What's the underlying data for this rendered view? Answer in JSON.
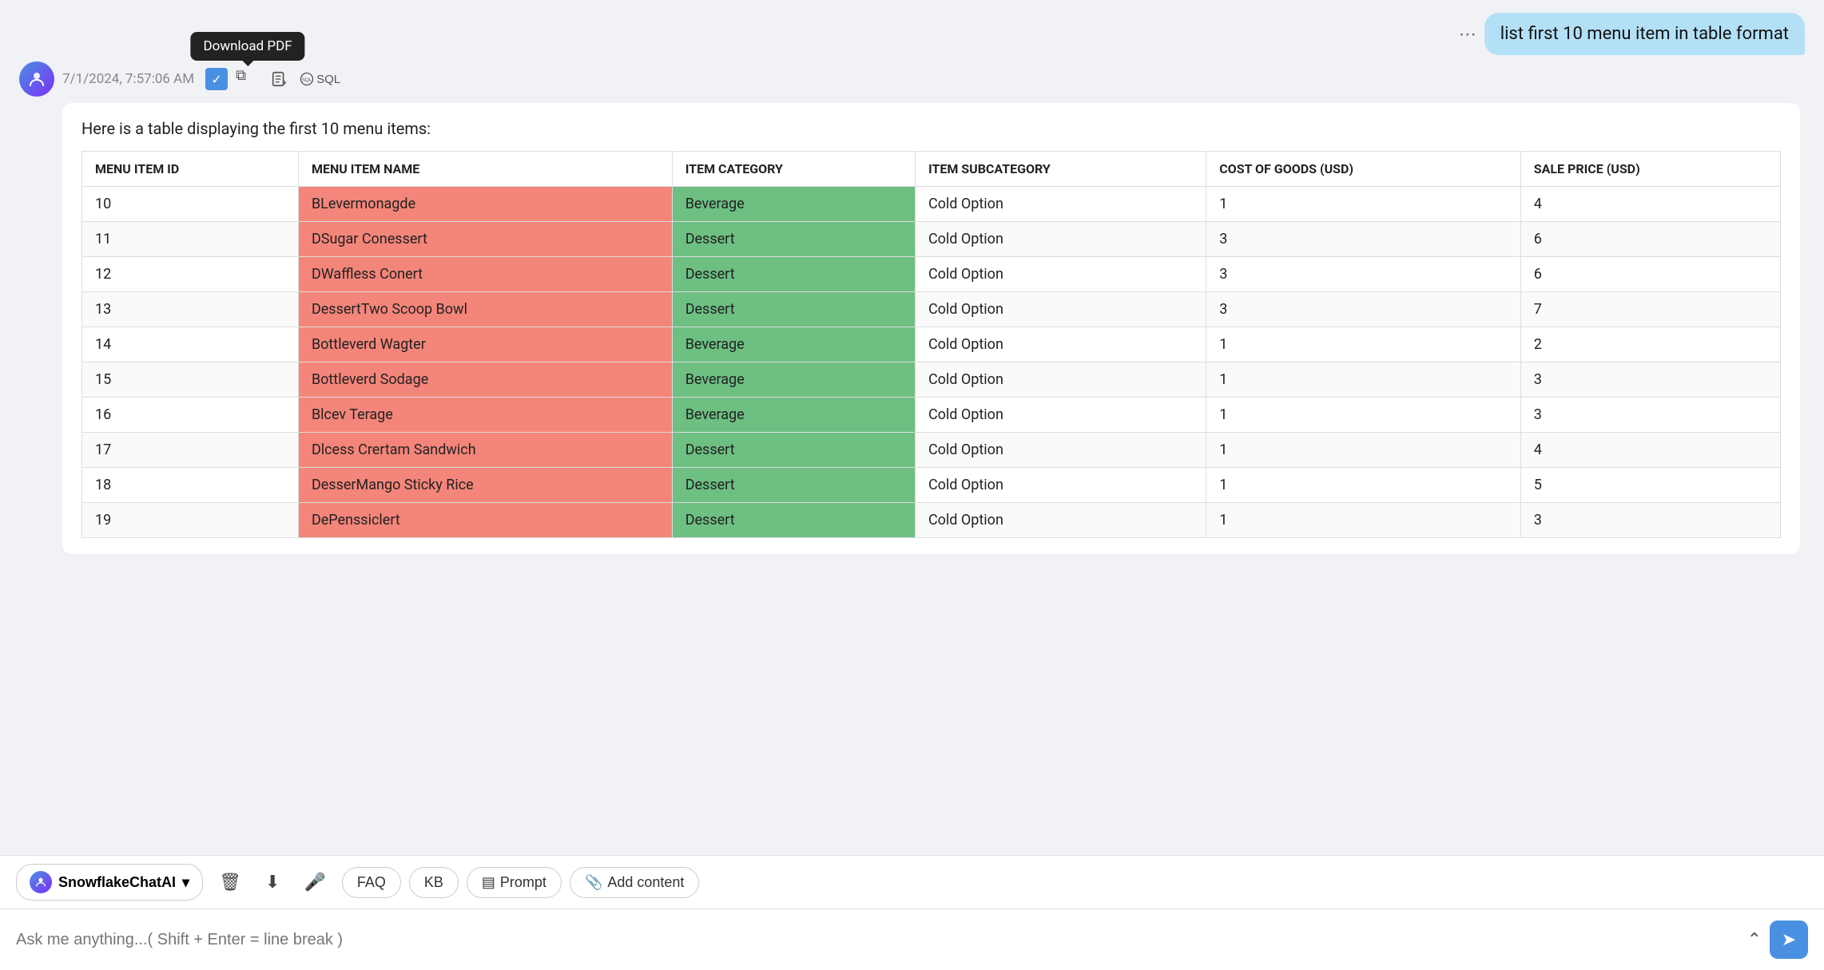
{
  "userMessage": {
    "text": "list first 10 menu item in table format"
  },
  "botMessage": {
    "timestamp": "7/1/2024, 7:57:06 AM",
    "intro": "Here is a table displaying the first 10 menu items:",
    "tooltip": "Download PDF"
  },
  "table": {
    "headers": [
      "MENU ITEM ID",
      "MENU ITEM NAME",
      "ITEM CATEGORY",
      "ITEM SUBCATEGORY",
      "COST OF GOODS (USD)",
      "SALE PRICE (USD)"
    ],
    "rows": [
      {
        "id": "10",
        "name": "BLevermonagde",
        "category": "Beverage",
        "subcategory": "Cold Option",
        "cost": "1",
        "price": "4"
      },
      {
        "id": "11",
        "name": "DSugar Conessert",
        "category": "Dessert",
        "subcategory": "Cold Option",
        "cost": "3",
        "price": "6"
      },
      {
        "id": "12",
        "name": "DWaffless Conert",
        "category": "Dessert",
        "subcategory": "Cold Option",
        "cost": "3",
        "price": "6"
      },
      {
        "id": "13",
        "name": "DessertTwo Scoop Bowl",
        "category": "Dessert",
        "subcategory": "Cold Option",
        "cost": "3",
        "price": "7"
      },
      {
        "id": "14",
        "name": "Bottleverd Wagter",
        "category": "Beverage",
        "subcategory": "Cold Option",
        "cost": "1",
        "price": "2"
      },
      {
        "id": "15",
        "name": "Bottleverd Sodage",
        "category": "Beverage",
        "subcategory": "Cold Option",
        "cost": "1",
        "price": "3"
      },
      {
        "id": "16",
        "name": "Blcev Terage",
        "category": "Beverage",
        "subcategory": "Cold Option",
        "cost": "1",
        "price": "3"
      },
      {
        "id": "17",
        "name": "Dlcess Crertam Sandwich",
        "category": "Dessert",
        "subcategory": "Cold Option",
        "cost": "1",
        "price": "4"
      },
      {
        "id": "18",
        "name": "DesserMango Sticky Rice",
        "category": "Dessert",
        "subcategory": "Cold Option",
        "cost": "1",
        "price": "5"
      },
      {
        "id": "19",
        "name": "DePenssiclert",
        "category": "Dessert",
        "subcategory": "Cold Option",
        "cost": "1",
        "price": "3"
      }
    ]
  },
  "toolbar": {
    "brand": "SnowflakeChatAI",
    "buttons": [
      "FAQ",
      "KB",
      "Prompt",
      "Add content"
    ]
  },
  "input": {
    "placeholder": "Ask me anything...( Shift + Enter = line break )"
  }
}
